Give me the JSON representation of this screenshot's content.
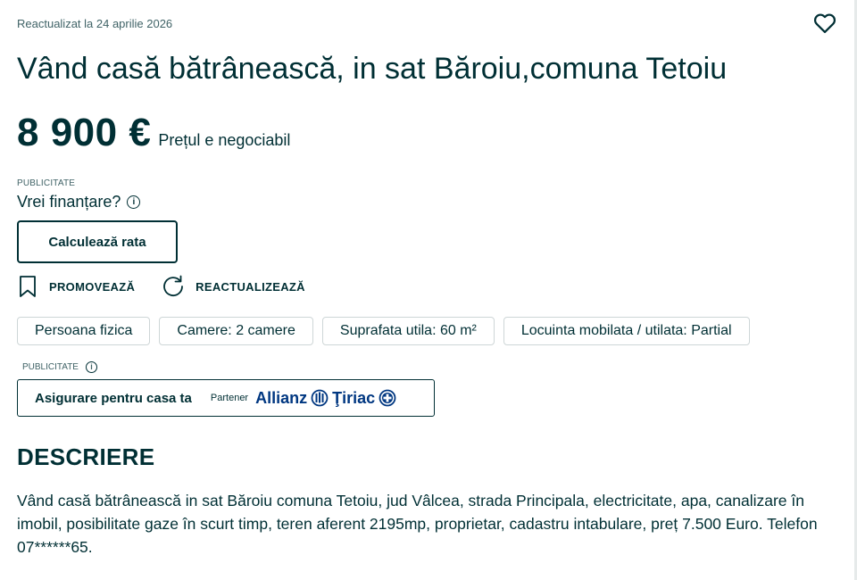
{
  "listing": {
    "updated": "Reactualizat la 24 aprilie 2026",
    "title": "Vând casă bătrânească, in sat Băroiu,comuna Tetoiu",
    "price": "8 900 €",
    "price_note": "Prețul e negociabil"
  },
  "financing": {
    "ad_label": "PUBLICITATE",
    "question": "Vrei finanțare?",
    "calc_button": "Calculează rata"
  },
  "actions": {
    "promote": "PROMOVEAZĂ",
    "refresh": "REACTUALIZEAZĂ"
  },
  "tags": [
    "Persoana fizica",
    "Camere: 2 camere",
    "Suprafata utila: 60 m²",
    "Locuinta mobilata / utilata: Partial"
  ],
  "insurance": {
    "ad_label": "PUBLICITATE",
    "label": "Asigurare pentru casa ta",
    "partner": "Partener",
    "brand_1": "Allianz",
    "brand_2": "Ţiriac"
  },
  "description": {
    "heading": "DESCRIERE",
    "text": "Vând casă bătrânească in sat Băroiu comuna Tetoiu, jud Vâlcea, strada Principala, electricitate, apa, canalizare în imobil, posibilitate gaze în scurt timp, teren aferent 2195mp, proprietar, cadastru intabulare, preț 7.500 Euro. Telefon 07******65."
  },
  "icons": {
    "favorite": "heart-icon",
    "promote": "bookmark-icon",
    "refresh": "refresh-icon",
    "info": "info-icon"
  },
  "colors": {
    "text": "#002f34",
    "muted": "#406367",
    "border": "#ced6d7",
    "allianz": "#003781"
  }
}
